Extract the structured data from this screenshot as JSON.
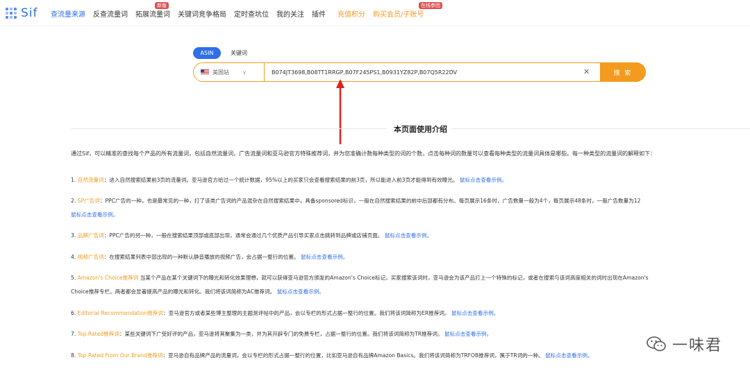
{
  "nav": {
    "logo": "Sif",
    "items": [
      {
        "label": "查流量来源",
        "active": true
      },
      {
        "label": "反查流量词"
      },
      {
        "label": "拓展流量词",
        "badge": "新版"
      },
      {
        "label": "关键词竞争格局"
      },
      {
        "label": "定时查坑位"
      },
      {
        "label": "我的关注"
      },
      {
        "label": "插件"
      },
      {
        "label": "充值积分",
        "orange": true
      },
      {
        "label": "购买会员/子账号",
        "orange": true,
        "badge": "在线参团"
      }
    ]
  },
  "search": {
    "tab_asin": "ASIN",
    "tab_keyword": "关键词",
    "country": "美国站",
    "asins": "B074JT3698,B08TT1RRGP,B07F245PS1,B0931YZ82P,B07Q5R22DV",
    "button": "搜 索"
  },
  "intro": {
    "title": "本页面使用介绍",
    "paragraph": "通过Sif，可以精准的查找每个产品的所有流量词，包括自然流量词，广告流量词和亚马逊官方特殊推荐词，并为您准确计数每种类型的词的个数，点击每种词的数量可以查看每种类型的流量词具体是哪些。每一种类型的流量词的解释如下：",
    "link": "鼠标点击查看示例。",
    "items": [
      {
        "no": "1.",
        "term": "自然流量词",
        "text": "：进入自然搜索结果前3页的流量词。亚马逊官方给过一个统计数据，95%以上的买家只会查看搜索结果的前3页，所以能进入前3页才能得到有效曝光。"
      },
      {
        "no": "2.",
        "term": "SP广告词",
        "text": "：PPC广告的一种，也是最常见的一种，打了该类广告词的产品混杂在自然搜索结果中，具备sponsored标识，一般在自然搜索结果的前中后部都有分布。每页展示16条时，广告数量一般为4个，每页展示48条时，一般广告数量为12"
      },
      {
        "no": "3.",
        "term": "品牌广告词",
        "text": "：PPC广告的另一种，一般在搜索结果顶部或底部出现，通常会通过几个优质产品引导买家点击跳转到品牌或店铺页面。"
      },
      {
        "no": "4.",
        "term": "视频广告词",
        "text": "：在搜索结果列表中部出现的一种默认静音播放的视频广告，会占据一整行的位置。"
      },
      {
        "no": "5.",
        "term": "Amazon's Choice推荐词",
        "text": " 当某个产品在某个关键词下的曝光和转化效果理想，就可以获得亚马逊官方颁发的Amazon's Choice标记，买家搜索该词时，亚马逊会为该产品打上一个特殊的标记，或者在搜索与该词高度相关的词时出现在Amazon's",
        "text2": "Choice推荐专栏。两者都会显著提高产品的曝光和转化。我们将该词简称为AC推荐词。"
      },
      {
        "no": "6.",
        "term": "Editorial Recommendation推荐词",
        "text": "：亚马逊官方或者某些博主整理的主题测评帖中的产品，会以专栏的形式占据一整行的位置。我们将该词简称为ER推荐词。"
      },
      {
        "no": "7.",
        "term": "Top Rated推荐词",
        "text": "：某些关键词下广受好评的产品，亚马逊将其聚集为一类，并为其开辟专门的免费专栏，占据一整行的位置。我们将该词简称为TR推荐词。"
      },
      {
        "no": "8.",
        "term": "Top Rated From Our Brand推荐词",
        "text": "：亚马逊自有品牌产品的流量词，会以专栏的形式占据一整行的位置，比如亚马逊自有品牌Amazon Basics。我们将该词简称为TRFOB推荐词，属于TR词的一种。"
      }
    ]
  },
  "watermark": "一味君"
}
